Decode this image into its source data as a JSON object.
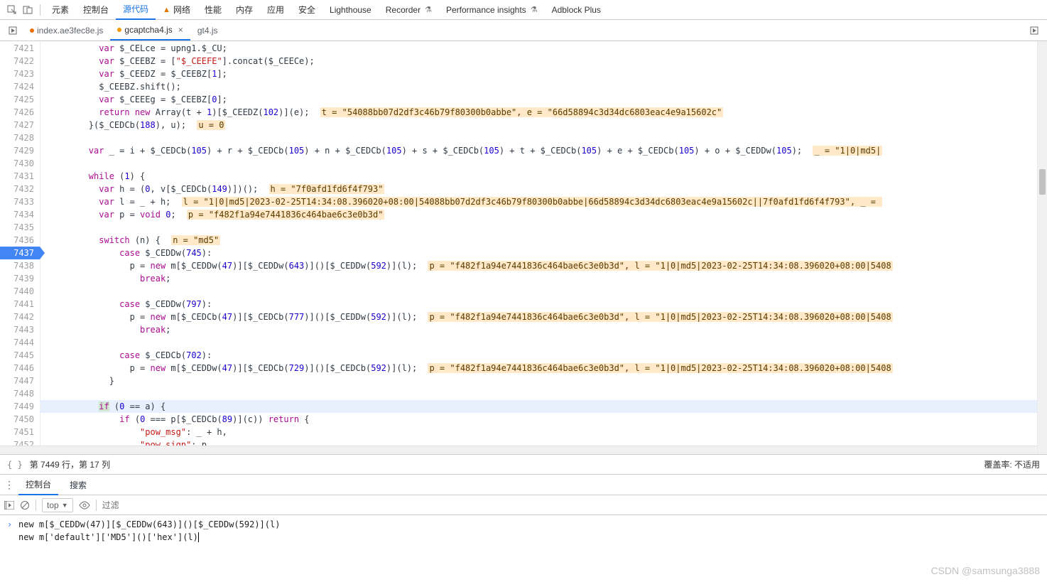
{
  "panels": {
    "elements": "元素",
    "console": "控制台",
    "sources": "源代码",
    "network": "网络",
    "performance": "性能",
    "memory": "内存",
    "application": "应用",
    "security": "安全",
    "lighthouse": "Lighthouse",
    "recorder": "Recorder",
    "perfInsights": "Performance insights",
    "adblock": "Adblock Plus"
  },
  "fileTabs": {
    "t1": "index.ae3fec8e.js",
    "t2": "gcaptcha4.js",
    "t3": "gt4.js"
  },
  "statusBar": {
    "pos": "第 7449 行，第 17 列",
    "coverage": "覆盖率: 不适用"
  },
  "drawerTabs": {
    "console": "控制台",
    "search": "搜索"
  },
  "consoleToolbar": {
    "context": "top",
    "filterPlaceholder": "过滤"
  },
  "consoleLines": {
    "l1": "new m[$_CEDDw(47)][$_CEDDw(643)]()[$_CEDDw(592)](l)",
    "l2": "new m['default']['MD5']()['hex'](l)"
  },
  "watermark": "CSDN @samsunga3888",
  "gutter": {
    "start": 7421,
    "exec": 7437,
    "hl": 7449,
    "count": 32
  },
  "code": {
    "r7421": "          var $_CELce = upng1.$_CU;",
    "r7422_a": "          var $_CEEBZ = [",
    "r7422_str": "\"$_CEEFE\"",
    "r7422_b": "].concat($_CEECe);",
    "r7423": "          var $_CEEDZ = $_CEEBZ[1];",
    "r7424": "          $_CEEBZ.shift();",
    "r7425": "          var $_CEEEg = $_CEEBZ[0];",
    "r7426_a": "          return new Array(t + 1)[$_CEEDZ(102)](e);",
    "r7426_hint": "t = \"54088bb07d2df3c46b79f80300b0abbe\", e = \"66d58894c3d34dc6803eac4e9a15602c\"",
    "r7427_a": "        }($_CEDCb(188), u);",
    "r7427_hint": "u = 0",
    "r7429_a": "        var _ = i + $_CEDCb(105) + r + $_CEDCb(105) + n + $_CEDCb(105) + s + $_CEDCb(105) + t + $_CEDCb(105) + e + $_CEDCb(105) + o + $_CEDDw(105);",
    "r7429_hint": "_ = \"1|0|md5|",
    "r7431": "        while (1) {",
    "r7432_a": "          var h = (0, v[$_CEDCb(149)])();",
    "r7432_hint": "h = \"7f0afd1fd6f4f793\"",
    "r7433_a": "          var l = _ + h;",
    "r7433_hint": "l = \"1|0|md5|2023-02-25T14:34:08.396020+08:00|54088bb07d2df3c46b79f80300b0abbe|66d58894c3d34dc6803eac4e9a15602c||7f0afd1fd6f4f793\", _ = ",
    "r7434_a": "          var p = void 0;",
    "r7434_hint": "p = \"f482f1a94e7441836c464bae6c3e0b3d\"",
    "r7436_a": "          switch (n) {",
    "r7436_hint": "n = \"md5\"",
    "r7437": "            case $_CEDDw(745):",
    "r7438_a": "              p = new m[$_CEDDw(47)][$_CEDDw(643)]()[$_CEDDw(592)](l);",
    "r7438_hint": "p = \"f482f1a94e7441836c464bae6c3e0b3d\", l = \"1|0|md5|2023-02-25T14:34:08.396020+08:00|5408",
    "r7439": "              break;",
    "r7441": "            case $_CEDDw(797):",
    "r7442_a": "              p = new m[$_CEDCb(47)][$_CEDCb(777)]()[$_CEDDw(592)](l);",
    "r7442_hint": "p = \"f482f1a94e7441836c464bae6c3e0b3d\", l = \"1|0|md5|2023-02-25T14:34:08.396020+08:00|5408",
    "r7443": "              break;",
    "r7445": "            case $_CEDCb(702):",
    "r7446_a": "              p = new m[$_CEDDw(47)][$_CEDCb(729)]()[$_CEDCb(592)](l);",
    "r7446_hint": "p = \"f482f1a94e7441836c464bae6c3e0b3d\", l = \"1|0|md5|2023-02-25T14:34:08.396020+08:00|5408",
    "r7447": "          }",
    "r7449_a": "          ",
    "r7449_if": "if",
    "r7449_b": " (0 == a) {",
    "r7450": "            if (0 === p[$_CEDCb(89)](c)) return {",
    "r7451": "              \"pow_msg\": _ + h,",
    "r7452": "              \"pow_sign\": p"
  }
}
